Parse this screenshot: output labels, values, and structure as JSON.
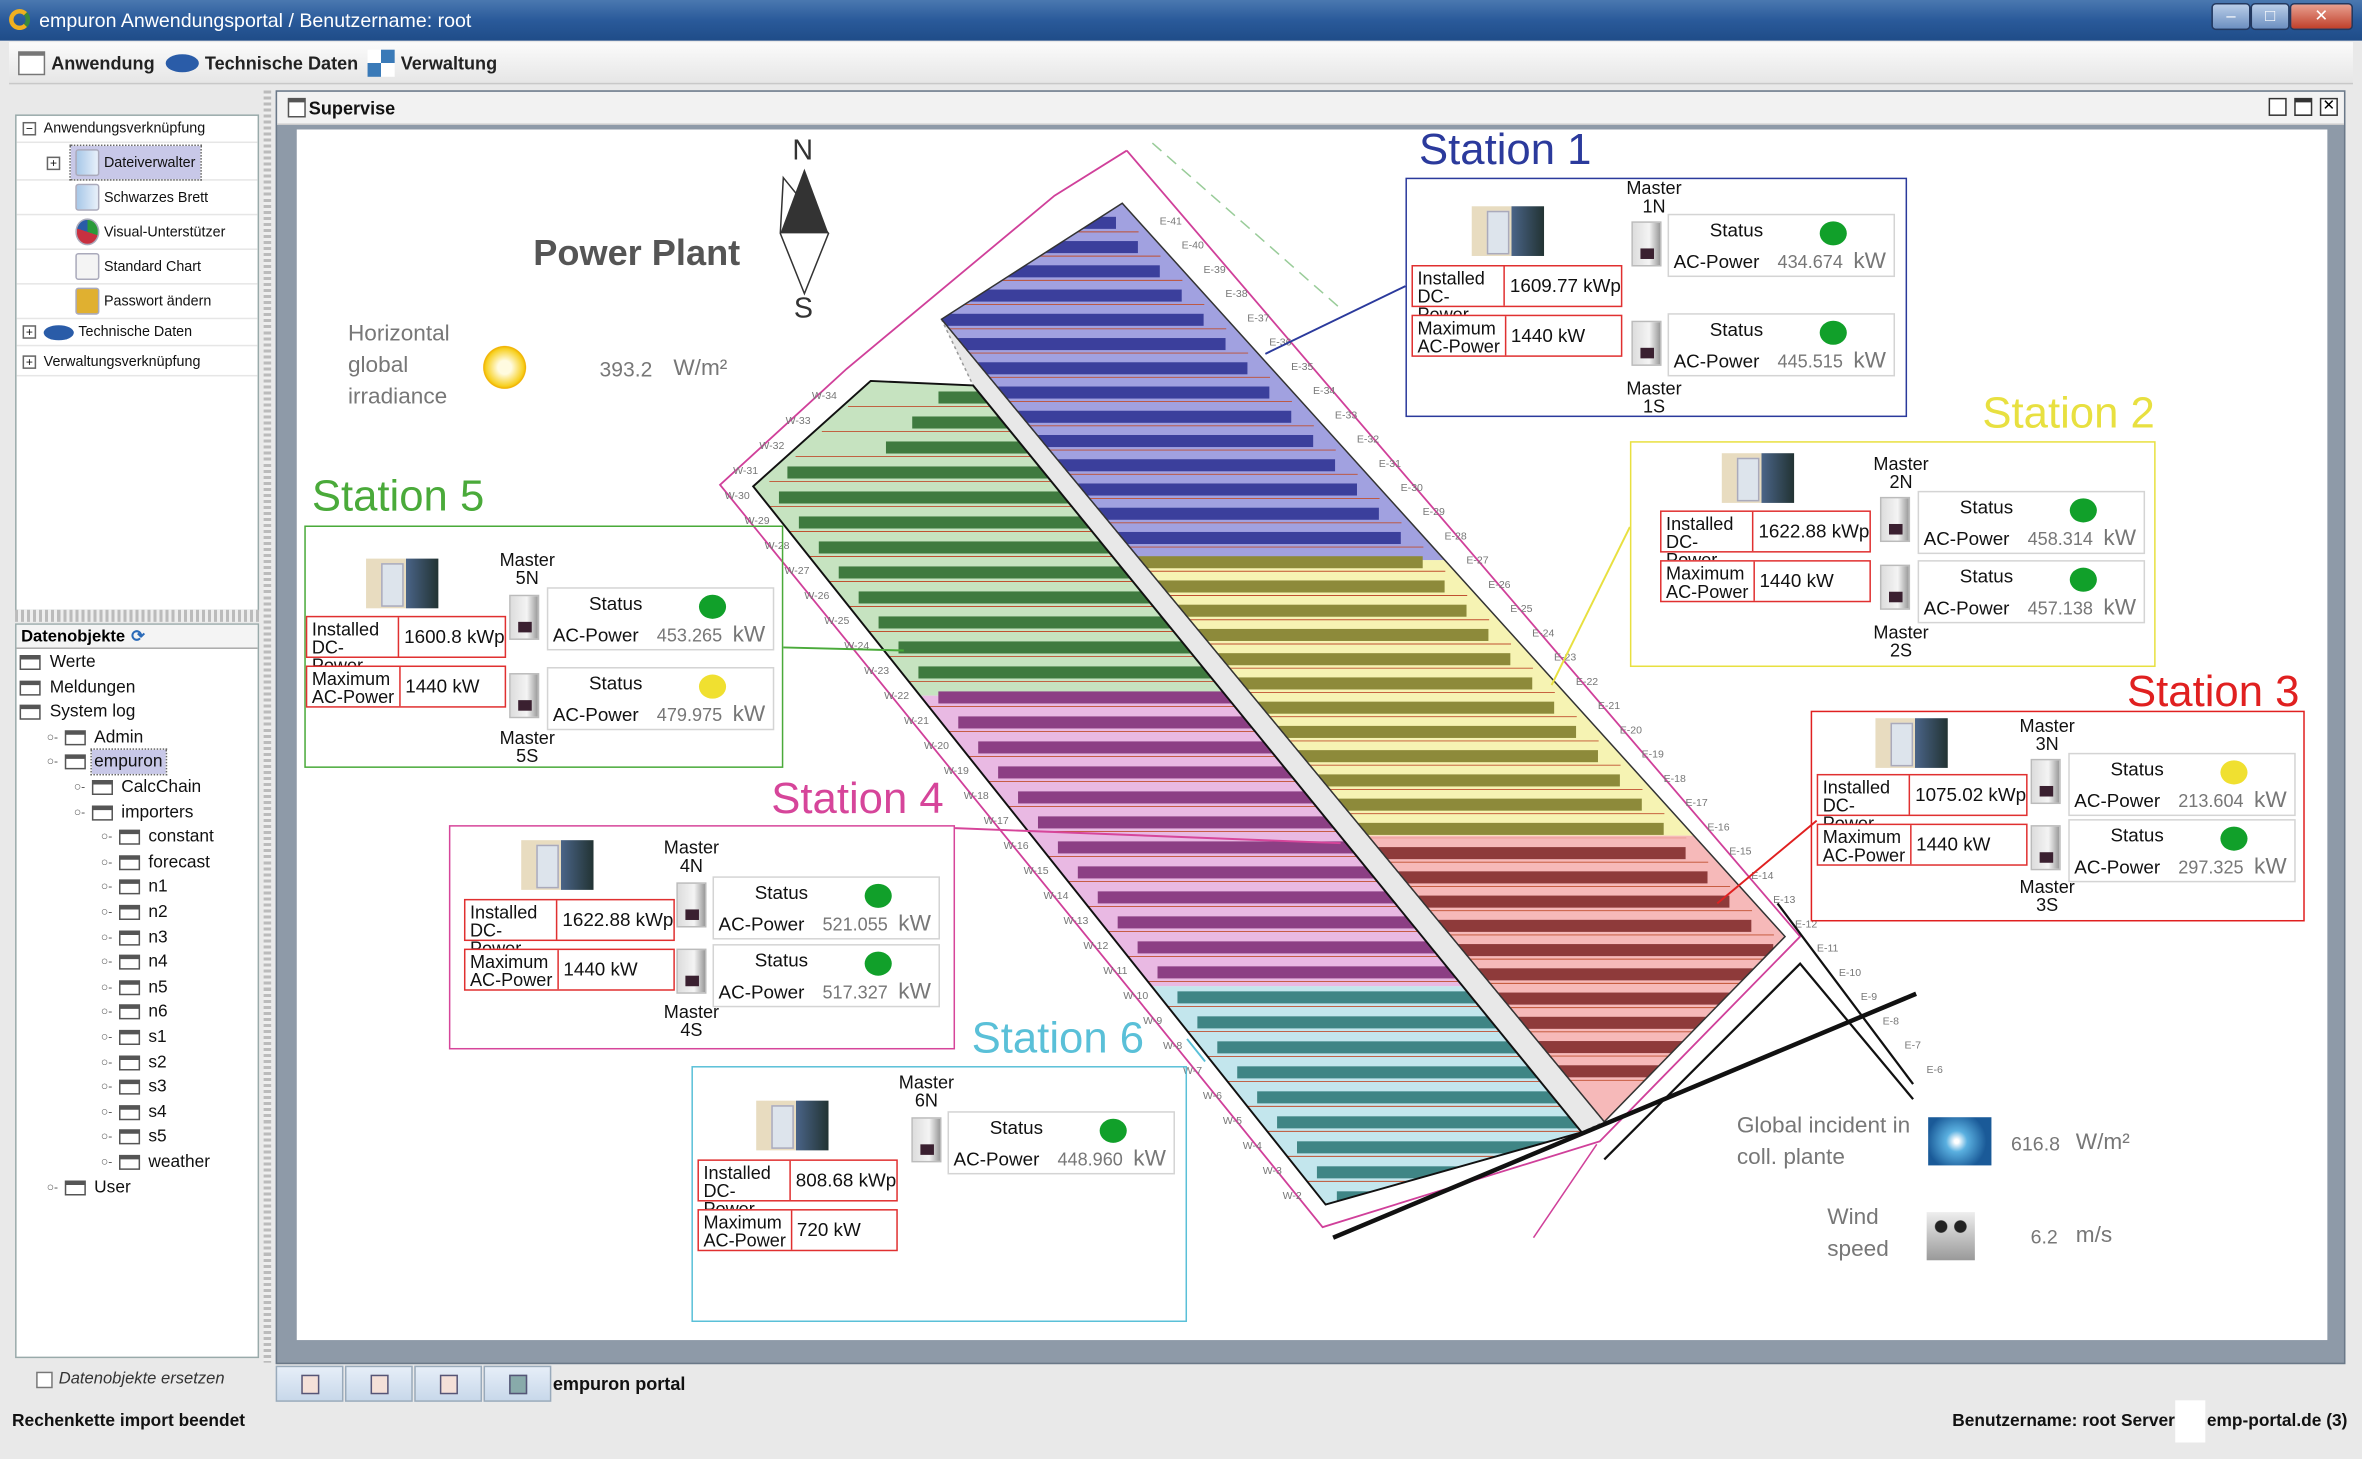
{
  "window": {
    "title": "empuron Anwendungsportal / Benutzername: root",
    "controls": [
      "minimize",
      "maximize",
      "close"
    ]
  },
  "menubar": [
    {
      "label": "Anwendung",
      "icon": "windows-icon"
    },
    {
      "label": "Technische Daten",
      "icon": "database-icon"
    },
    {
      "label": "Verwaltung",
      "icon": "arrows-icon"
    }
  ],
  "nav_tree": [
    {
      "label": "Anwendungsverknüpfung",
      "expanded": true,
      "children": [
        {
          "label": "Dateiverwalter",
          "icon": "folder-icon",
          "selected": true,
          "expandable": true
        },
        {
          "label": "Schwarzes Brett",
          "icon": "folder-icon"
        },
        {
          "label": "Visual-Unterstützer",
          "icon": "pie-chart-icon"
        },
        {
          "label": "Standard Chart",
          "icon": "chart-icon"
        },
        {
          "label": "Passwort ändern",
          "icon": "lock-icon"
        }
      ]
    },
    {
      "label": "Technische Daten",
      "expanded": false,
      "icon": "database-icon"
    },
    {
      "label": "Verwaltungsverknüpfung",
      "expanded": false
    }
  ],
  "data_objects": {
    "header": "Datenobjekte",
    "replace_label": "Datenobjekte ersetzen",
    "items": [
      {
        "label": "Werte",
        "depth": 0
      },
      {
        "label": "Meldungen",
        "depth": 0
      },
      {
        "label": "System log",
        "depth": 0
      },
      {
        "label": "Admin",
        "depth": 1
      },
      {
        "label": "empuron",
        "depth": 1,
        "selected": true
      },
      {
        "label": "CalcChain",
        "depth": 2
      },
      {
        "label": "importers",
        "depth": 2
      },
      {
        "label": "constant",
        "depth": 3
      },
      {
        "label": "forecast",
        "depth": 3
      },
      {
        "label": "n1",
        "depth": 3
      },
      {
        "label": "n2",
        "depth": 3
      },
      {
        "label": "n3",
        "depth": 3
      },
      {
        "label": "n4",
        "depth": 3
      },
      {
        "label": "n5",
        "depth": 3
      },
      {
        "label": "n6",
        "depth": 3
      },
      {
        "label": "s1",
        "depth": 3
      },
      {
        "label": "s2",
        "depth": 3
      },
      {
        "label": "s3",
        "depth": 3
      },
      {
        "label": "s4",
        "depth": 3
      },
      {
        "label": "s5",
        "depth": 3
      },
      {
        "label": "weather",
        "depth": 3
      },
      {
        "label": "User",
        "depth": 1
      }
    ]
  },
  "main": {
    "tab_title": "Supervise",
    "plant_title": "Power Plant",
    "compass": {
      "north": "N",
      "south": "S"
    },
    "irradiance": {
      "label": [
        "Horizontal",
        "global",
        "irradiance"
      ],
      "value": "393.2",
      "unit": "W/m²"
    },
    "incident": {
      "label": [
        "Global incident in",
        "coll. plante"
      ],
      "value": "616.8",
      "unit": "W/m²"
    },
    "wind": {
      "label": [
        "Wind",
        "speed"
      ],
      "value": "6.2",
      "unit": "m/s"
    },
    "row_labels_east": [
      "E-41",
      "E-40",
      "E-39",
      "E-38",
      "E-37",
      "E-36",
      "E-35",
      "E-34",
      "E-33",
      "E-32",
      "E-31",
      "E-30",
      "E-29",
      "E-28",
      "E-27",
      "E-26",
      "E-25",
      "E-24",
      "E-23",
      "E-22",
      "E-21",
      "E-20",
      "E-19",
      "E-18",
      "E-17",
      "E-16",
      "E-15",
      "E-14",
      "E-13",
      "E-12",
      "E-11",
      "E-10",
      "E-9",
      "E-8",
      "E-7",
      "E-6"
    ],
    "row_labels_west": [
      "W-34",
      "W-33",
      "W-32",
      "W-31",
      "W-30",
      "W-29",
      "W-28",
      "W-27",
      "W-26",
      "W-25",
      "W-24",
      "W-23",
      "W-22",
      "W-21",
      "W-20",
      "W-19",
      "W-18",
      "W-17",
      "W-16",
      "W-15",
      "W-14",
      "W-13",
      "W-12",
      "W-11",
      "W-10",
      "W-9",
      "W-8",
      "W-7",
      "W-6",
      "W-5",
      "W-4",
      "W-3",
      "W-2"
    ]
  },
  "labels": {
    "status": "Status",
    "ac_power": "AC-Power",
    "installed": "Installed DC-Power",
    "maximum": "Maximum AC-Power",
    "master": "Master"
  },
  "colors": {
    "green": "#11a02a",
    "yellow": "#f0e030"
  },
  "stations": [
    {
      "name": "Station 1",
      "color": "#2b3a9c",
      "installed": "1609.77 kWp",
      "maximum": "1440 kW",
      "masters": [
        {
          "id": "1N",
          "status": "green",
          "ac_power": "434.674",
          "unit": "kW"
        },
        {
          "id": "1S",
          "status": "green",
          "ac_power": "445.515",
          "unit": "kW"
        }
      ]
    },
    {
      "name": "Station 2",
      "color": "#e8e040",
      "installed": "1622.88 kWp",
      "maximum": "1440 kW",
      "masters": [
        {
          "id": "2N",
          "status": "green",
          "ac_power": "458.314",
          "unit": "kW"
        },
        {
          "id": "2S",
          "status": "green",
          "ac_power": "457.138",
          "unit": "kW"
        }
      ]
    },
    {
      "name": "Station 3",
      "color": "#e02020",
      "installed": "1075.02 kWp",
      "maximum": "1440 kW",
      "masters": [
        {
          "id": "3N",
          "status": "yellow",
          "ac_power": "213.604",
          "unit": "kW"
        },
        {
          "id": "3S",
          "status": "green",
          "ac_power": "297.325",
          "unit": "kW"
        }
      ]
    },
    {
      "name": "Station 4",
      "color": "#d6459a",
      "installed": "1622.88 kWp",
      "maximum": "1440 kW",
      "masters": [
        {
          "id": "4N",
          "status": "green",
          "ac_power": "521.055",
          "unit": "kW"
        },
        {
          "id": "4S",
          "status": "green",
          "ac_power": "517.327",
          "unit": "kW"
        }
      ]
    },
    {
      "name": "Station 5",
      "color": "#4aaa3a",
      "installed": "1600.8 kWp",
      "maximum": "1440 kW",
      "masters": [
        {
          "id": "5N",
          "status": "green",
          "ac_power": "453.265",
          "unit": "kW"
        },
        {
          "id": "5S",
          "status": "yellow",
          "ac_power": "479.975",
          "unit": "kW"
        }
      ]
    },
    {
      "name": "Station 6",
      "color": "#5ac0d8",
      "installed": "808.68 kWp",
      "maximum": "720 kW",
      "masters": [
        {
          "id": "6N",
          "status": "green",
          "ac_power": "448.960",
          "unit": "kW"
        }
      ]
    }
  ],
  "bottom_tabs": {
    "label": "empuron portal",
    "buttons": [
      "tile-icon",
      "stack-icon",
      "external-icon",
      "window-icon"
    ]
  },
  "statusbar": {
    "message": "Rechenkette import beendet",
    "user": "Benutzername: root",
    "server_label": "Server:",
    "server": "emp-portal.de (3)"
  }
}
